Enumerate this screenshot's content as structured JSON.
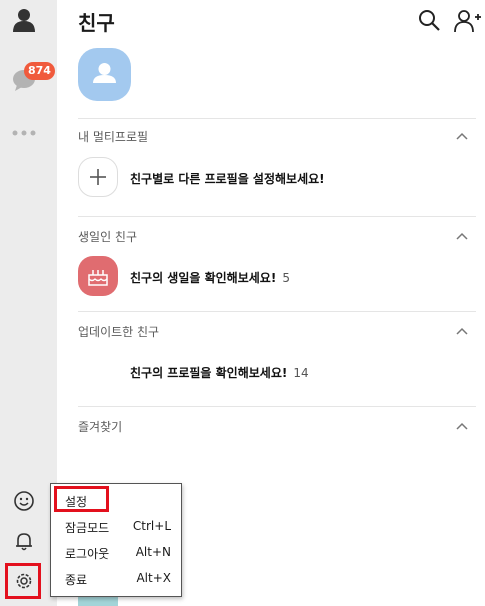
{
  "header": {
    "title": "친구"
  },
  "sidebar": {
    "items": [
      {
        "name": "friends",
        "icon": "person-icon"
      },
      {
        "name": "chats",
        "icon": "chat-bubble-icon",
        "badge": "874"
      },
      {
        "name": "more",
        "icon": "more-dots-icon"
      }
    ],
    "bottom": [
      {
        "name": "emoticon",
        "icon": "smiley-icon"
      },
      {
        "name": "notifications",
        "icon": "bell-icon"
      },
      {
        "name": "settings",
        "icon": "gear-icon"
      }
    ]
  },
  "sections": {
    "multiprofile": {
      "label": "내 멀티프로필",
      "row_text": "친구별로 다른 프로필을 설정해보세요!"
    },
    "birthday": {
      "label": "생일인 친구",
      "row_text": "친구의 생일을 확인해보세요!",
      "count": "5"
    },
    "updated": {
      "label": "업데이트한 친구",
      "row_text": "친구의 프로필을 확인해보세요!",
      "count": "14"
    },
    "favorites": {
      "label": "즐겨찾기"
    }
  },
  "context_menu": {
    "items": [
      {
        "label": "설정",
        "shortcut": ""
      },
      {
        "label": "잠금모드",
        "shortcut": "Ctrl+L"
      },
      {
        "label": "로그아웃",
        "shortcut": "Alt+N"
      },
      {
        "label": "종료",
        "shortcut": "Alt+X"
      }
    ]
  },
  "colors": {
    "badge": "#f05a3c",
    "sidebar_bg": "#ececec",
    "avatar": "#a3c9ef",
    "birthday_icon": "#e06c70",
    "highlight": "#e3101d"
  }
}
